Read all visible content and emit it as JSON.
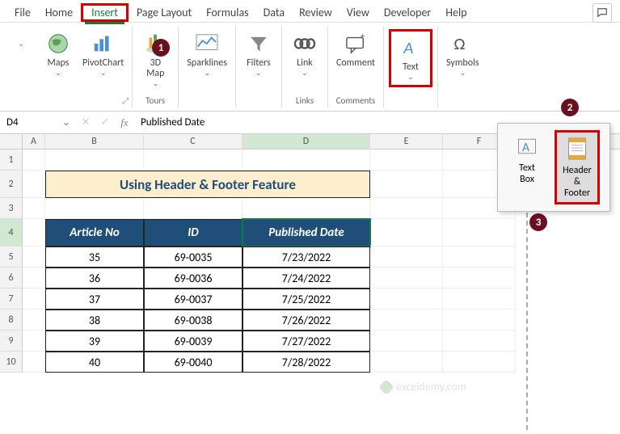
{
  "menu": {
    "items": [
      "File",
      "Home",
      "Insert",
      "Page Layout",
      "Formulas",
      "Data",
      "Review",
      "View",
      "Developer",
      "Help"
    ],
    "active": "Insert"
  },
  "ribbon": {
    "maps": "Maps",
    "pivotchart": "PivotChart",
    "map3d": "3D\nMap",
    "sparklines": "Sparklines",
    "filters": "Filters",
    "link": "Link",
    "comment": "Comment",
    "text": "Text",
    "symbols": "Symbols",
    "group_tours": "Tours",
    "group_links": "Links",
    "group_comments": "Comments"
  },
  "text_dropdown": {
    "textbox": "Text\nBox",
    "headerfooter": "Header\n& Footer"
  },
  "steps": {
    "s1": "1",
    "s2": "2",
    "s3": "3"
  },
  "formula_bar": {
    "name_box": "D4",
    "formula": "Published Date"
  },
  "columns": [
    "A",
    "B",
    "C",
    "D",
    "E",
    "F"
  ],
  "sheet_title": "Using Header & Footer Feature",
  "table": {
    "headers": [
      "Article No",
      "ID",
      "Published Date"
    ],
    "rows": [
      [
        "35",
        "69-0035",
        "7/23/2022"
      ],
      [
        "36",
        "69-0036",
        "7/24/2022"
      ],
      [
        "37",
        "69-0037",
        "7/25/2022"
      ],
      [
        "38",
        "69-0038",
        "7/26/2022"
      ],
      [
        "39",
        "69-0039",
        "7/27/2022"
      ],
      [
        "40",
        "69-0040",
        "7/28/2022"
      ]
    ]
  },
  "watermark": "exceldemy.com"
}
